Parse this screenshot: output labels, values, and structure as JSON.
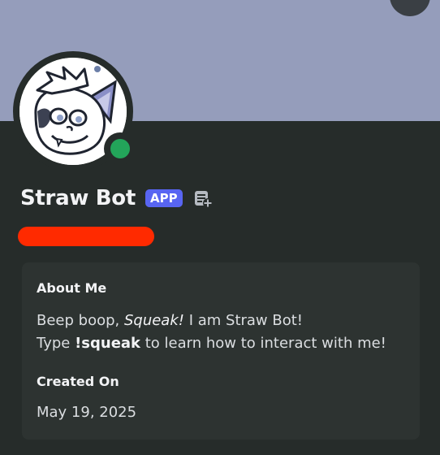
{
  "profile": {
    "display_name": "Straw Bot",
    "app_badge": "APP",
    "status": "online"
  },
  "about": {
    "title": "About Me",
    "line1_prefix": "Beep boop, ",
    "line1_italic": "Squeak!",
    "line1_suffix": " I am Straw Bot!",
    "line2_prefix": "Type ",
    "line2_bold": "!squeak",
    "line2_suffix": " to learn how to interact with me!"
  },
  "created": {
    "title": "Created On",
    "date": "May 19, 2025"
  },
  "icons": {
    "note": "note-add-icon",
    "status": "online-status-icon"
  },
  "colors": {
    "banner": "#959dbb",
    "panel": "#262c2a",
    "card": "#2d3331",
    "app_badge": "#5865f2",
    "online": "#23a55a",
    "redaction": "#ff2a00"
  }
}
